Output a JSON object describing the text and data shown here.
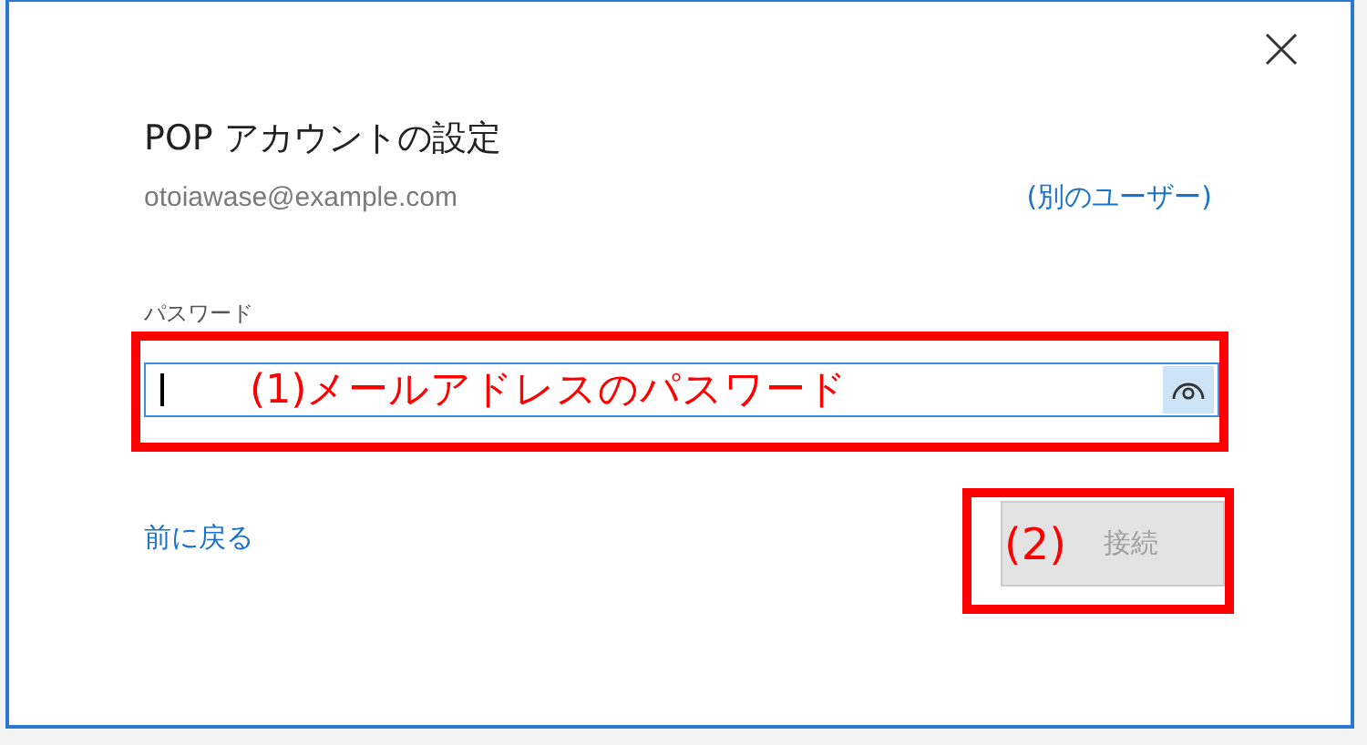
{
  "dialog": {
    "title": "POP アカウントの設定",
    "email": "otoiawase@example.com",
    "switch_user_link": "(別のユーザー)",
    "password": {
      "label": "パスワード",
      "focused": true,
      "annotation": "(1)メールアドレスのパスワード"
    },
    "back_link": "前に戻る",
    "connect_button": {
      "label": "接続",
      "disabled": true,
      "annotation": "(2)"
    }
  }
}
